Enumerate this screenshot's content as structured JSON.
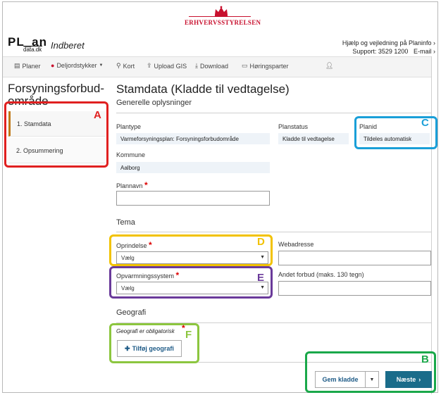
{
  "header": {
    "brand": "Erhvervsstyrelsen",
    "logo_main": "PL_an",
    "logo_sub": "data.dk",
    "indberet": "Indberet",
    "help_link": "Hjælp og vejledning på Planinfo",
    "support_label": "Support: 3529 1200",
    "email_link": "E-mail"
  },
  "nav": {
    "items": [
      {
        "label": "Planer",
        "icon": "file-icon"
      },
      {
        "label": "Deljordstykker",
        "icon": "map-pin-icon"
      },
      {
        "label": "Kort",
        "icon": "location-icon"
      },
      {
        "label": "Upload GIS",
        "icon": "upload-icon"
      },
      {
        "label": "Download",
        "icon": "download-icon"
      },
      {
        "label": "Høringsparter",
        "icon": "card-icon"
      }
    ]
  },
  "sidebar": {
    "title": "Forsyningsforbud-område",
    "steps": [
      "1. Stamdata",
      "2. Opsummering"
    ]
  },
  "main": {
    "title": "Stamdata (Kladde til vedtagelse)",
    "subtitle": "Generelle oplysninger",
    "plantype_label": "Plantype",
    "plantype_value": "Varmeforsyningsplan: Forsyningsforbudområde",
    "planstatus_label": "Planstatus",
    "planstatus_value": "Kladde til vedtagelse",
    "planid_label": "Planid",
    "planid_value": "Tildeles automatisk",
    "kommune_label": "Kommune",
    "kommune_value": "Aalborg",
    "plannavn_label": "Plannavn",
    "plannavn_value": "",
    "tema_heading": "Tema",
    "oprindelse_label": "Oprindelse",
    "oprindelse_value": "Vælg",
    "webadresse_label": "Webadresse",
    "webadresse_value": "",
    "opvarmning_label": "Opvarmningssystem",
    "opvarmning_value": "Vælg",
    "andet_label": "Andet forbud (maks. 130 tegn)",
    "andet_value": "",
    "geografi_heading": "Geografi",
    "geografi_note": "Geografi er obligatorisk",
    "tilfoej_label": "Tilføj geografi",
    "required_mark": "*"
  },
  "footer": {
    "gem_label": "Gem kladde",
    "naeste_label": "Næste"
  },
  "annotations": {
    "A": "A",
    "B": "B",
    "C": "C",
    "D": "D",
    "E": "E",
    "F": "F"
  },
  "colors": {
    "accent": "#1a6c8a",
    "brand_red": "#c8102e",
    "required": "#dd0000",
    "box_red": "#e02020",
    "box_green": "#1aa84a",
    "box_blue": "#1a9fd8",
    "box_yellow": "#f2c200",
    "box_purple": "#6a3a9a",
    "box_lightgreen": "#8cc63f"
  }
}
